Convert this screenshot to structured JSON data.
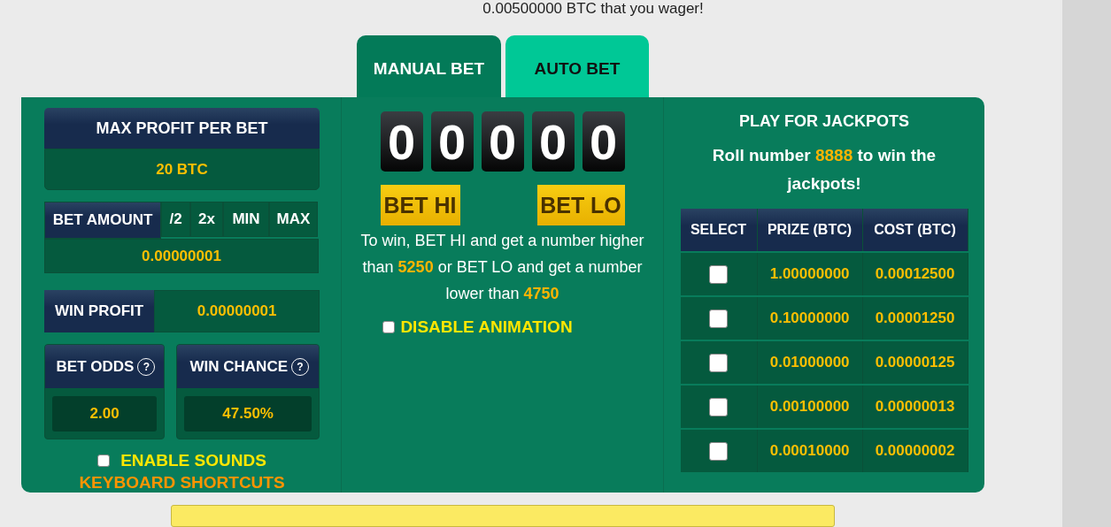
{
  "intro": "0.00500000 BTC that you wager!",
  "tabs": [
    {
      "label": "MANUAL BET",
      "selected": true
    },
    {
      "label": "AUTO BET",
      "selected": false
    }
  ],
  "left": {
    "max_profit": {
      "label": "MAX PROFIT PER BET",
      "value": "20 BTC"
    },
    "bet_amount": {
      "label": "BET AMOUNT",
      "buttons": [
        "/2",
        "2x",
        "MIN",
        "MAX"
      ],
      "value": "0.00000001"
    },
    "win_profit": {
      "label": "WIN PROFIT",
      "value": "0.00000001"
    },
    "odds": [
      {
        "label": "BET ODDS",
        "help": "?",
        "value": "2.00"
      },
      {
        "label": "WIN CHANCE",
        "help": "?",
        "value": "47.50%"
      }
    ],
    "enable_sounds": {
      "label": "ENABLE SOUNDS",
      "checked": false
    },
    "keyboard_shortcuts": "KEYBOARD SHORTCUTS"
  },
  "middle": {
    "digits": [
      "0",
      "0",
      "0",
      "0",
      "0"
    ],
    "buttons": [
      "BET HI",
      "BET LO"
    ],
    "rule": "To win, BET HI and get a number higher than **5250** or BET LO and get a number lower than **4750**",
    "disable_animation": {
      "label": "DISABLE ANIMATION",
      "checked": false
    }
  },
  "jackpots": {
    "title": "PLAY FOR JACKPOTS",
    "subtitle": "Roll number **8888** to win the jackpots!",
    "columns": [
      "SELECT",
      "PRIZE (BTC)",
      "COST (BTC)"
    ],
    "rows": [
      {
        "selected": false,
        "prize": "1.00000000",
        "cost": "0.00012500"
      },
      {
        "selected": false,
        "prize": "0.10000000",
        "cost": "0.00001250"
      },
      {
        "selected": false,
        "prize": "0.01000000",
        "cost": "0.00000125"
      },
      {
        "selected": false,
        "prize": "0.00100000",
        "cost": "0.00000013"
      },
      {
        "selected": false,
        "prize": "0.00010000",
        "cost": "0.00000002"
      }
    ]
  }
}
